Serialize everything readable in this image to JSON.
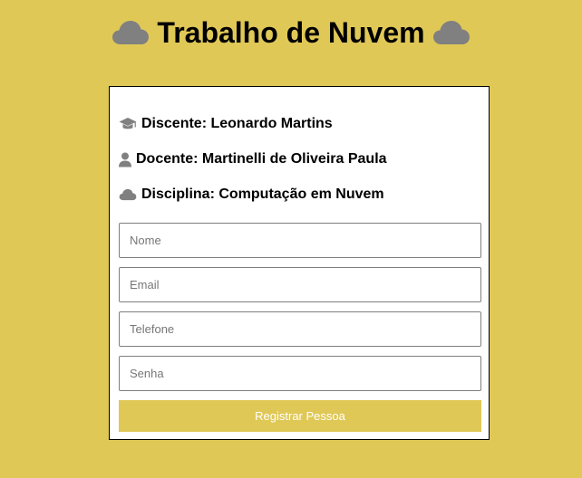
{
  "header": {
    "title": "Trabalho de Nuvem",
    "left_icon": "cloud-icon",
    "right_icon": "cloud-icon"
  },
  "info": {
    "student": {
      "icon": "graduation-cap-icon",
      "text": "Discente: Leonardo Martins"
    },
    "teacher": {
      "icon": "user-icon",
      "text": "Docente: Martinelli de Oliveira Paula"
    },
    "course": {
      "icon": "cloud-icon",
      "text": "Disciplina: Computação em Nuvem"
    }
  },
  "form": {
    "name_placeholder": "Nome",
    "email_placeholder": "Email",
    "phone_placeholder": "Telefone",
    "password_placeholder": "Senha",
    "submit_label": "Registrar Pessoa"
  },
  "colors": {
    "background": "#e0c857",
    "card": "#ffffff",
    "icon_gray": "#808080",
    "button_text": "#ffffff"
  }
}
